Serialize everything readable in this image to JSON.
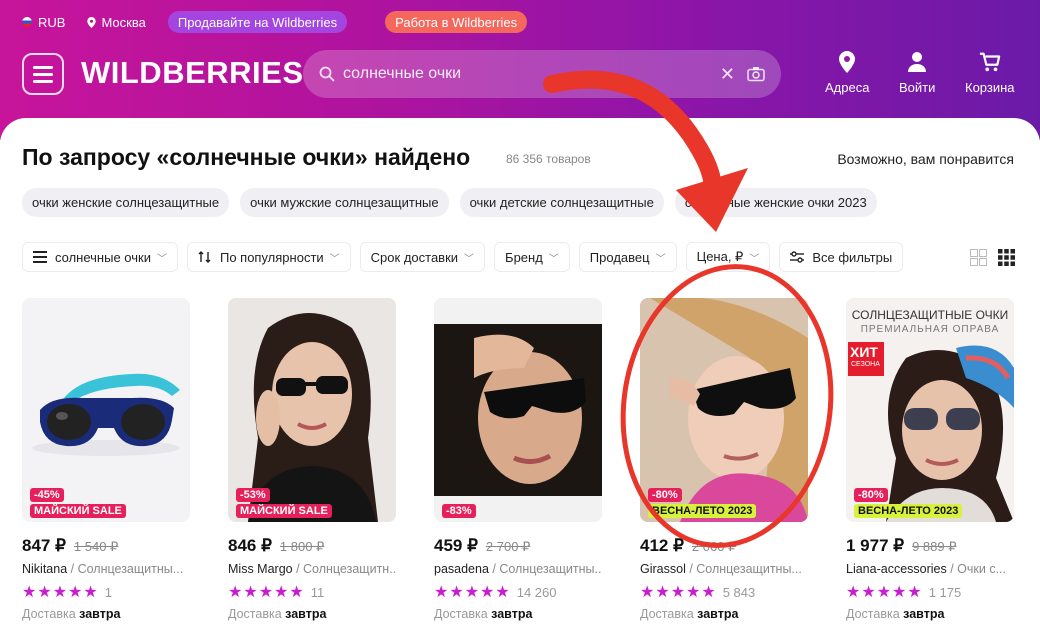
{
  "topbar": {
    "currency": "RUB",
    "city": "Москва",
    "sell_pill": "Продавайте на Wildberries",
    "work_pill": "Работа в Wildberries"
  },
  "header": {
    "logo": "WILDBERRIES",
    "search_value": "солнечные очки",
    "addresses": "Адреса",
    "login": "Войти",
    "cart": "Корзина"
  },
  "results": {
    "title": "По запросу «солнечные очки» найдено",
    "count": "86 356 товаров",
    "maybe_like": "Возможно, вам понравится"
  },
  "chips": [
    "очки женские солнцезащитные",
    "очки мужские солнцезащитные",
    "очки детские солнцезащитные",
    "солнечные женские очки 2023"
  ],
  "filters": {
    "query": "солнечные очки",
    "sort": "По популярности",
    "delivery": "Срок доставки",
    "brand": "Бренд",
    "seller": "Продавец",
    "price": "Цена, ₽",
    "all": "Все фильтры"
  },
  "products": [
    {
      "price": "847 ₽",
      "old_price": "1 540 ₽",
      "seller": "Nikitana",
      "category": "Солнцезащитны...",
      "rating_count": "1",
      "delivery_label": "Доставка",
      "delivery_when": "завтра",
      "discount": "-45%",
      "badge": "МАЙСКИЙ SALE"
    },
    {
      "price": "846 ₽",
      "old_price": "1 800 ₽",
      "seller": "Miss Margo",
      "category": "Солнцезащитн...",
      "rating_count": "11",
      "delivery_label": "Доставка",
      "delivery_when": "завтра",
      "discount": "-53%",
      "badge": "МАЙСКИЙ SALE"
    },
    {
      "price": "459 ₽",
      "old_price": "2 700 ₽",
      "seller": "pasadena",
      "category": "Солнцезащитны...",
      "rating_count": "14 260",
      "delivery_label": "Доставка",
      "delivery_when": "завтра",
      "discount": "-83%",
      "badge": ""
    },
    {
      "price": "412 ₽",
      "old_price": "2 060 ₽",
      "seller": "Girassol",
      "category": "Солнцезащитны...",
      "rating_count": "5 843",
      "delivery_label": "Доставка",
      "delivery_when": "завтра",
      "discount": "-80%",
      "badge": "ВЕСНА-ЛЕТО 2023"
    },
    {
      "price": "1 977 ₽",
      "old_price": "9 889 ₽",
      "seller": "Liana-accessories",
      "category": "Очки с...",
      "rating_count": "1 175",
      "delivery_label": "Доставка",
      "delivery_when": "завтра",
      "discount": "-80%",
      "badge": "ВЕСНА-ЛЕТО 2023",
      "promo_title": "СОЛНЦЕЗАЩИТНЫЕ ОЧКИ",
      "promo_sub": "ПРЕМИАЛЬНАЯ ОПРАВА",
      "promo_hit": "ХИТ",
      "promo_season": "СЕЗОНА"
    }
  ],
  "stars": "★★★★★",
  "colors": {
    "brand_gradient_start": "#c7149b",
    "brand_gradient_end": "#6b1aa8",
    "discount": "#e5205a",
    "spring_badge": "#d8f23c",
    "star": "#c81ed0",
    "annotation": "#e8362a"
  }
}
